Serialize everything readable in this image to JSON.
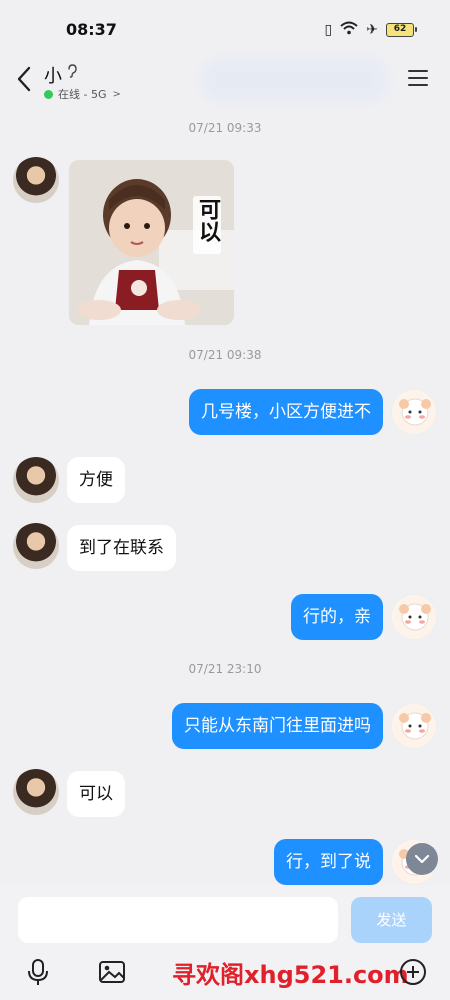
{
  "status_bar": {
    "time": "08:37",
    "battery": "62"
  },
  "header": {
    "contact_name": "小",
    "online_text": "在线 - 5G"
  },
  "messages": [
    {
      "type": "timestamp",
      "text": "07/21 09:33"
    },
    {
      "type": "sticker",
      "from": "her",
      "sticker_text": "可以"
    },
    {
      "type": "timestamp",
      "text": "07/21 09:38"
    },
    {
      "type": "text",
      "from": "me",
      "text": "几号楼，小区方便进不"
    },
    {
      "type": "text",
      "from": "her",
      "text": "方便"
    },
    {
      "type": "text",
      "from": "her",
      "text": "到了在联系"
    },
    {
      "type": "text",
      "from": "me",
      "text": "行的，亲"
    },
    {
      "type": "timestamp",
      "text": "07/21 23:10"
    },
    {
      "type": "text",
      "from": "me",
      "text": "只能从东南门往里面进吗"
    },
    {
      "type": "text",
      "from": "her",
      "text": "可以"
    },
    {
      "type": "text",
      "from": "me",
      "text": "行，到了说"
    }
  ],
  "input": {
    "send_label": "发送"
  },
  "watermark": "寻欢阁xhg521.com",
  "colors": {
    "bubble_out": "#1e90ff",
    "bubble_in": "#ffffff",
    "online": "#35c95a",
    "send_disabled": "#a9d3fb"
  }
}
